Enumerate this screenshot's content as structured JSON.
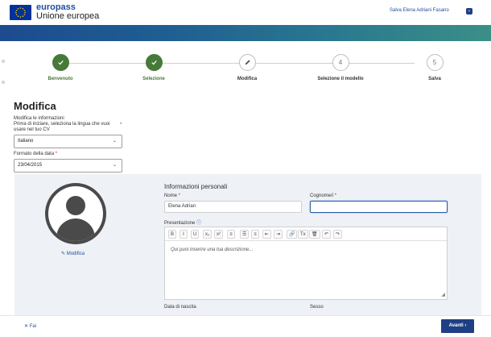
{
  "header": {
    "logo_name": "europass",
    "logo_sub": "Unione europea",
    "save_link": "Salva Elena Adriani Fasano",
    "save_icon": "save-icon"
  },
  "stepper": {
    "steps": [
      {
        "label": "Benvenuto",
        "state": "done",
        "icon": "check-icon"
      },
      {
        "label": "Selezione",
        "state": "done",
        "icon": "check-icon"
      },
      {
        "label": "Modifica",
        "state": "active",
        "icon": "pencil-icon"
      },
      {
        "label": "Selezione il modello",
        "state": "todo",
        "number": "4"
      },
      {
        "label": "Salva",
        "state": "todo",
        "number": "5"
      }
    ]
  },
  "main": {
    "title": "Modifica",
    "intro_line1": "Modifica le informazioni",
    "intro_line2": "Prima di iniziare, seleziona la lingua che vuoi",
    "intro_line3": "usare nel tuo CV",
    "required_mark": "*",
    "language_value": "Italiano",
    "date_format_label": "Formato della data",
    "date_format_value": "23/04/2015"
  },
  "personal": {
    "photo_edit_label": "Modifica",
    "section_title": "Informazioni personali",
    "name_label": "Nome",
    "name_value": "Elena Adrian",
    "surname_label": "Cognome/i",
    "surname_value": "",
    "presentation_label": "Presentazione",
    "presentation_placeholder": "Qui puoi inserire una tua descrizione...",
    "birthdate_label": "Data di nascita",
    "gender_label": "Sesso"
  },
  "toolbar": {
    "buttons": [
      "B",
      "I",
      "U",
      "x₂",
      "x²",
      "≡",
      "☰",
      "≡",
      "⇤",
      "⇥",
      "🔗",
      "Tx",
      "🗑",
      "↶",
      "↷"
    ]
  },
  "footer": {
    "back_label": "Fai",
    "next_label": "Avanti"
  },
  "colors": {
    "primary": "#1f3f85",
    "done": "#467a39",
    "link": "#1f4e9c"
  }
}
